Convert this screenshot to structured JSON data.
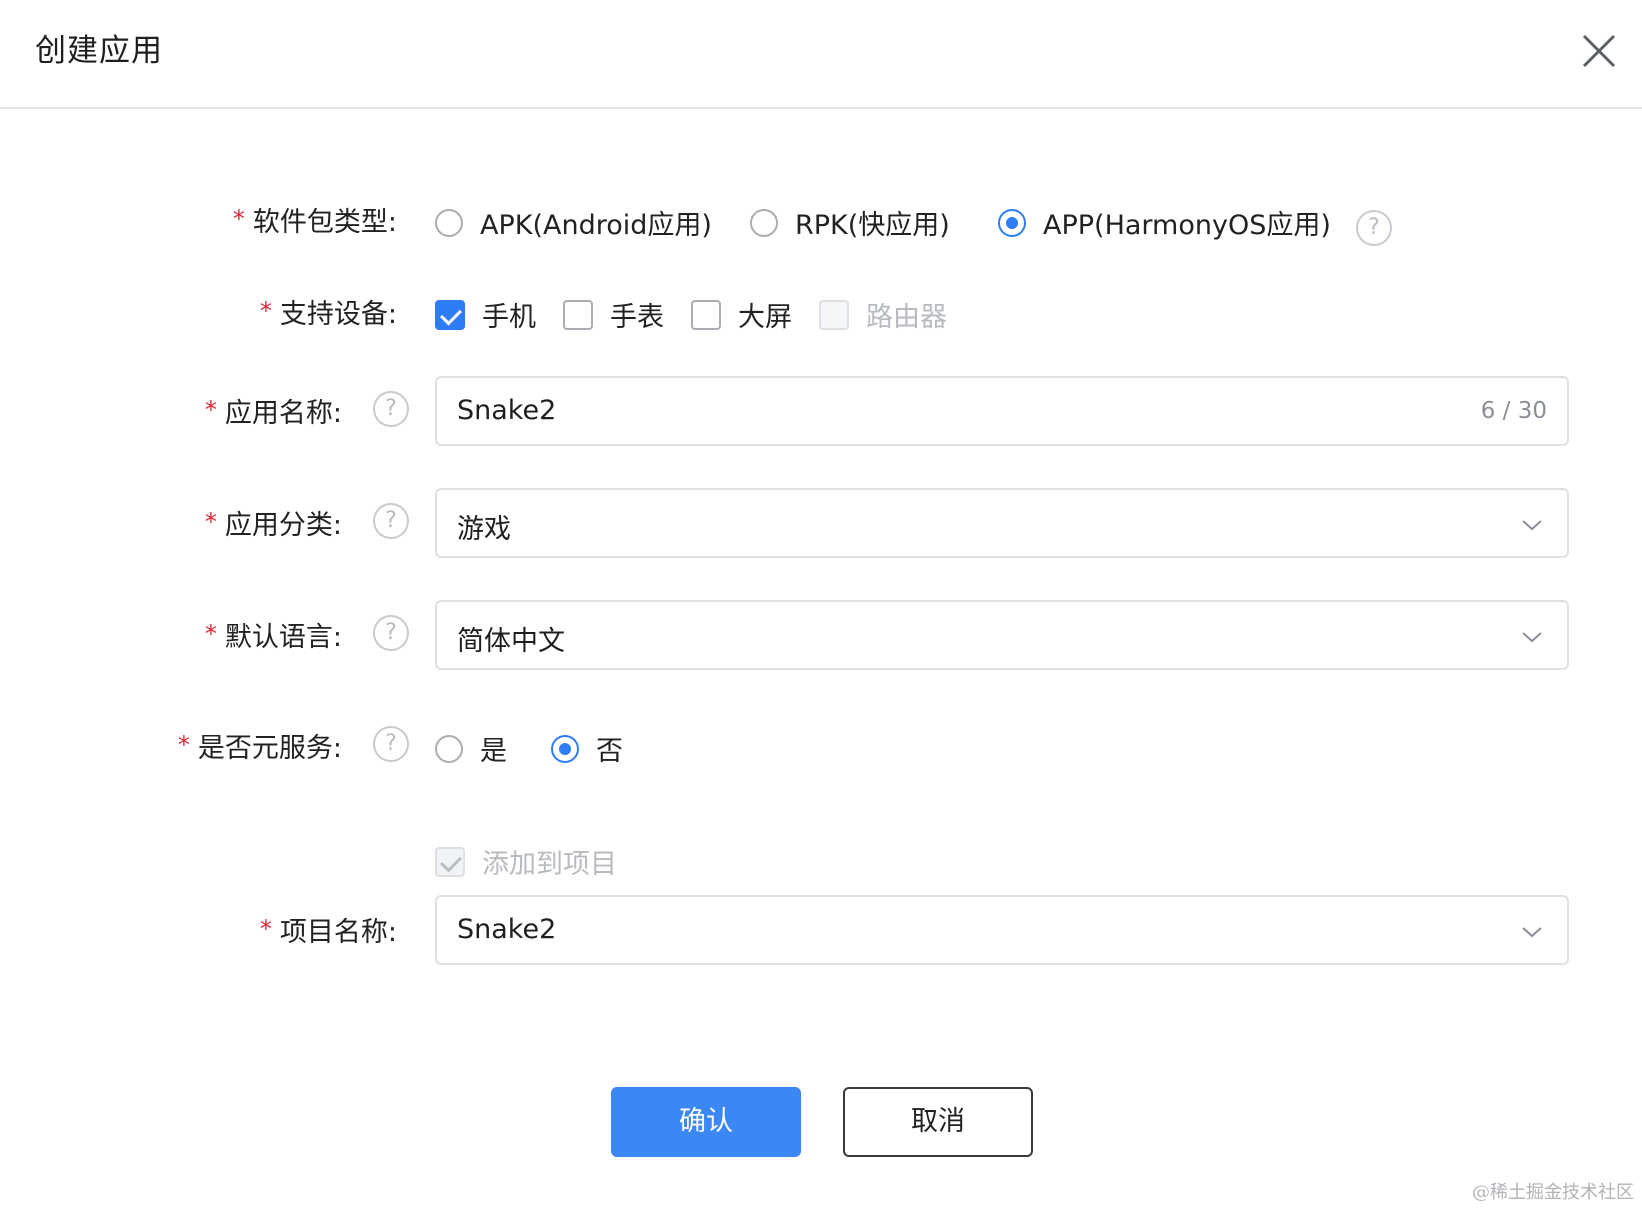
{
  "dialog": {
    "title": "创建应用"
  },
  "form": {
    "package_type": {
      "label": "软件包类型:",
      "options": [
        "APK(Android应用)",
        "RPK(快应用)",
        "APP(HarmonyOS应用)"
      ],
      "selected": "APP(HarmonyOS应用)"
    },
    "devices": {
      "label": "支持设备:",
      "options": [
        "手机",
        "手表",
        "大屏",
        "路由器"
      ],
      "checked": [
        "手机"
      ],
      "disabled": [
        "路由器"
      ]
    },
    "app_name": {
      "label": "应用名称:",
      "value": "Snake2",
      "counter": "6 / 30"
    },
    "category": {
      "label": "应用分类:",
      "value": "游戏"
    },
    "language": {
      "label": "默认语言:",
      "value": "简体中文"
    },
    "atomic_service": {
      "label": "是否元服务:",
      "options": [
        "是",
        "否"
      ],
      "selected": "否"
    },
    "add_to_project": {
      "label": "添加到项目",
      "checked": true,
      "disabled": true
    },
    "project_name": {
      "label": "项目名称:",
      "value": "Snake2"
    }
  },
  "required_mark": "*",
  "help_glyph": "?",
  "buttons": {
    "confirm": "确认",
    "cancel": "取消"
  },
  "watermark": "@稀土掘金技术社区",
  "colors": {
    "accent": "#2f7df6",
    "required": "#e0283a",
    "border": "#dfe1e5"
  }
}
